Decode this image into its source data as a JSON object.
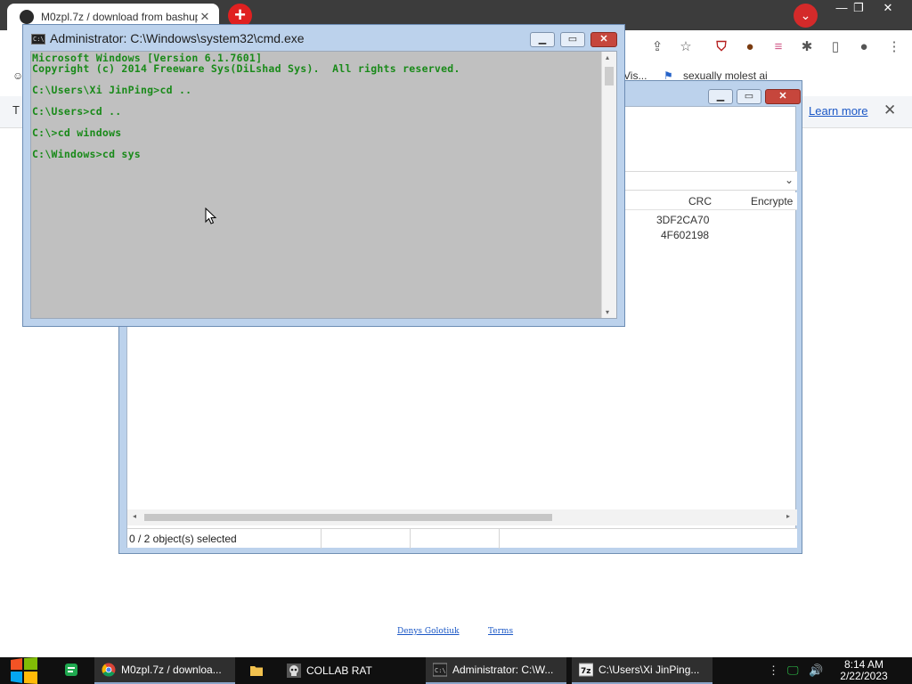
{
  "browser": {
    "tab_title": "M0zpl.7z / download from bashupload",
    "bookmark_1": "Vis...",
    "bookmark_2": "sexually molest ai",
    "infobar_prefix": "T",
    "learn_more": "Learn more",
    "footer_link_1": "Denys Golotiuk",
    "footer_link_2": "Terms"
  },
  "zip": {
    "columns": {
      "crc": "CRC",
      "encrypted": "Encrypte"
    },
    "rows": [
      {
        "crc": "3DF2CA70"
      },
      {
        "crc": "4F602198"
      }
    ],
    "status": "0 / 2 object(s) selected"
  },
  "cmd": {
    "title": "Administrator: C:\\Windows\\system32\\cmd.exe",
    "lines": [
      "Microsoft Windows [Version 6.1.7601]",
      "Copyright (c) 2014 Freeware Sys(DiLshad Sys).  All rights reserved.",
      "C:\\Users\\Xi JinPing>cd ..",
      "C:\\Users>cd ..",
      "C:\\>cd windows",
      "C:\\Windows>cd sys"
    ]
  },
  "taskbar": {
    "items": [
      {
        "label": "M0zpl.7z / downloa..."
      },
      {
        "label": "COLLAB RAT"
      },
      {
        "label": "Administrator: C:\\W..."
      },
      {
        "label": "C:\\Users\\Xi JinPing..."
      }
    ],
    "time": "8:14 AM",
    "date": "2/22/2023"
  },
  "colors": {
    "cmd_text": "#198a19",
    "cmd_bg": "#c0c0c0",
    "window_frame": "#bcd2ec",
    "close_button": "#c6463c",
    "link": "#1a57c6"
  }
}
